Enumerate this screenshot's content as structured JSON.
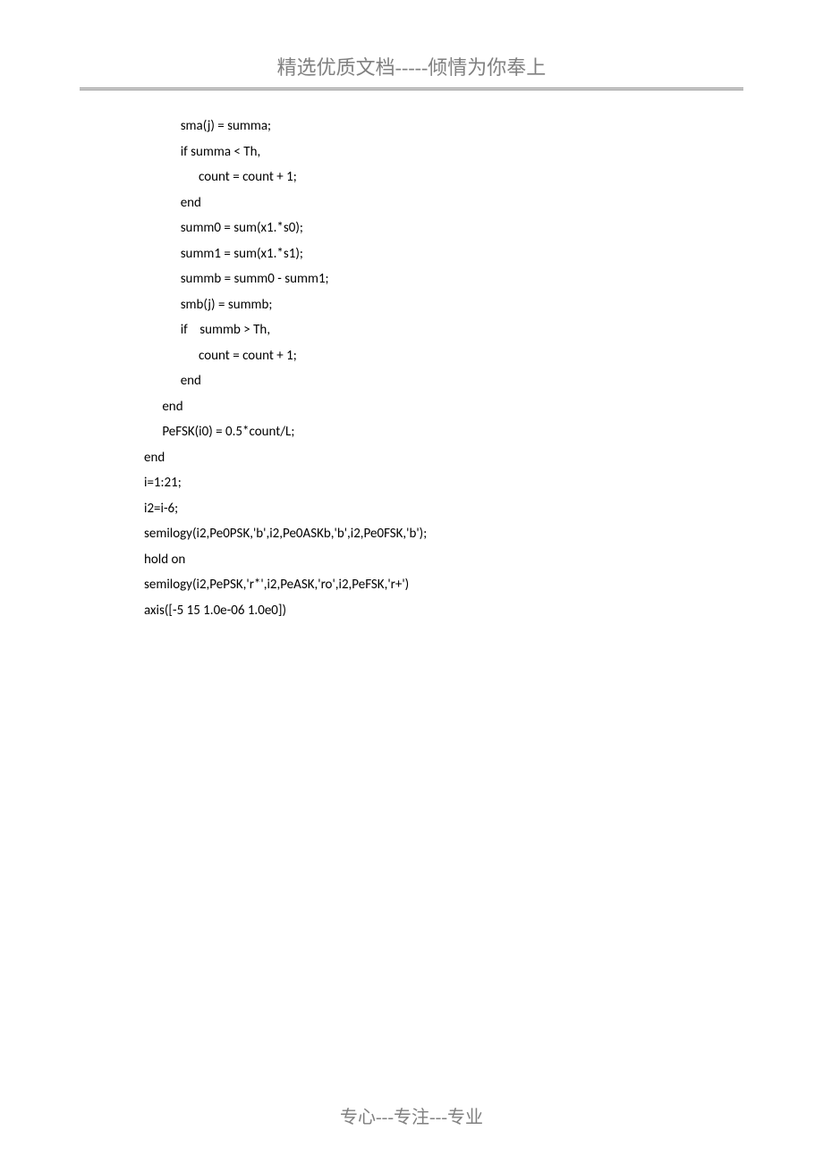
{
  "header": {
    "text": "精选优质文档-----倾情为你奉上"
  },
  "code": {
    "lines": [
      "            sma(j) = summa;",
      "            if summa < Th,",
      "                  count = count + 1;",
      "            end",
      "            summ0 = sum(x1.*s0);",
      "            summ1 = sum(x1.*s1);",
      "            summb = summ0 - summ1;",
      "            smb(j) = summb;",
      "            if    summb > Th,",
      "                  count = count + 1;",
      "            end",
      "      end",
      "      PeFSK(i0) = 0.5*count/L;",
      "end",
      "i=1:21;",
      "i2=i-6;",
      "semilogy(i2,Pe0PSK,'b',i2,Pe0ASKb,'b',i2,Pe0FSK,'b');",
      "hold on",
      "semilogy(i2,PePSK,'r*',i2,PeASK,'ro',i2,PeFSK,'r+')",
      "axis([-5 15 1.0e-06 1.0e0])"
    ]
  },
  "footer": {
    "text": "专心---专注---专业"
  }
}
